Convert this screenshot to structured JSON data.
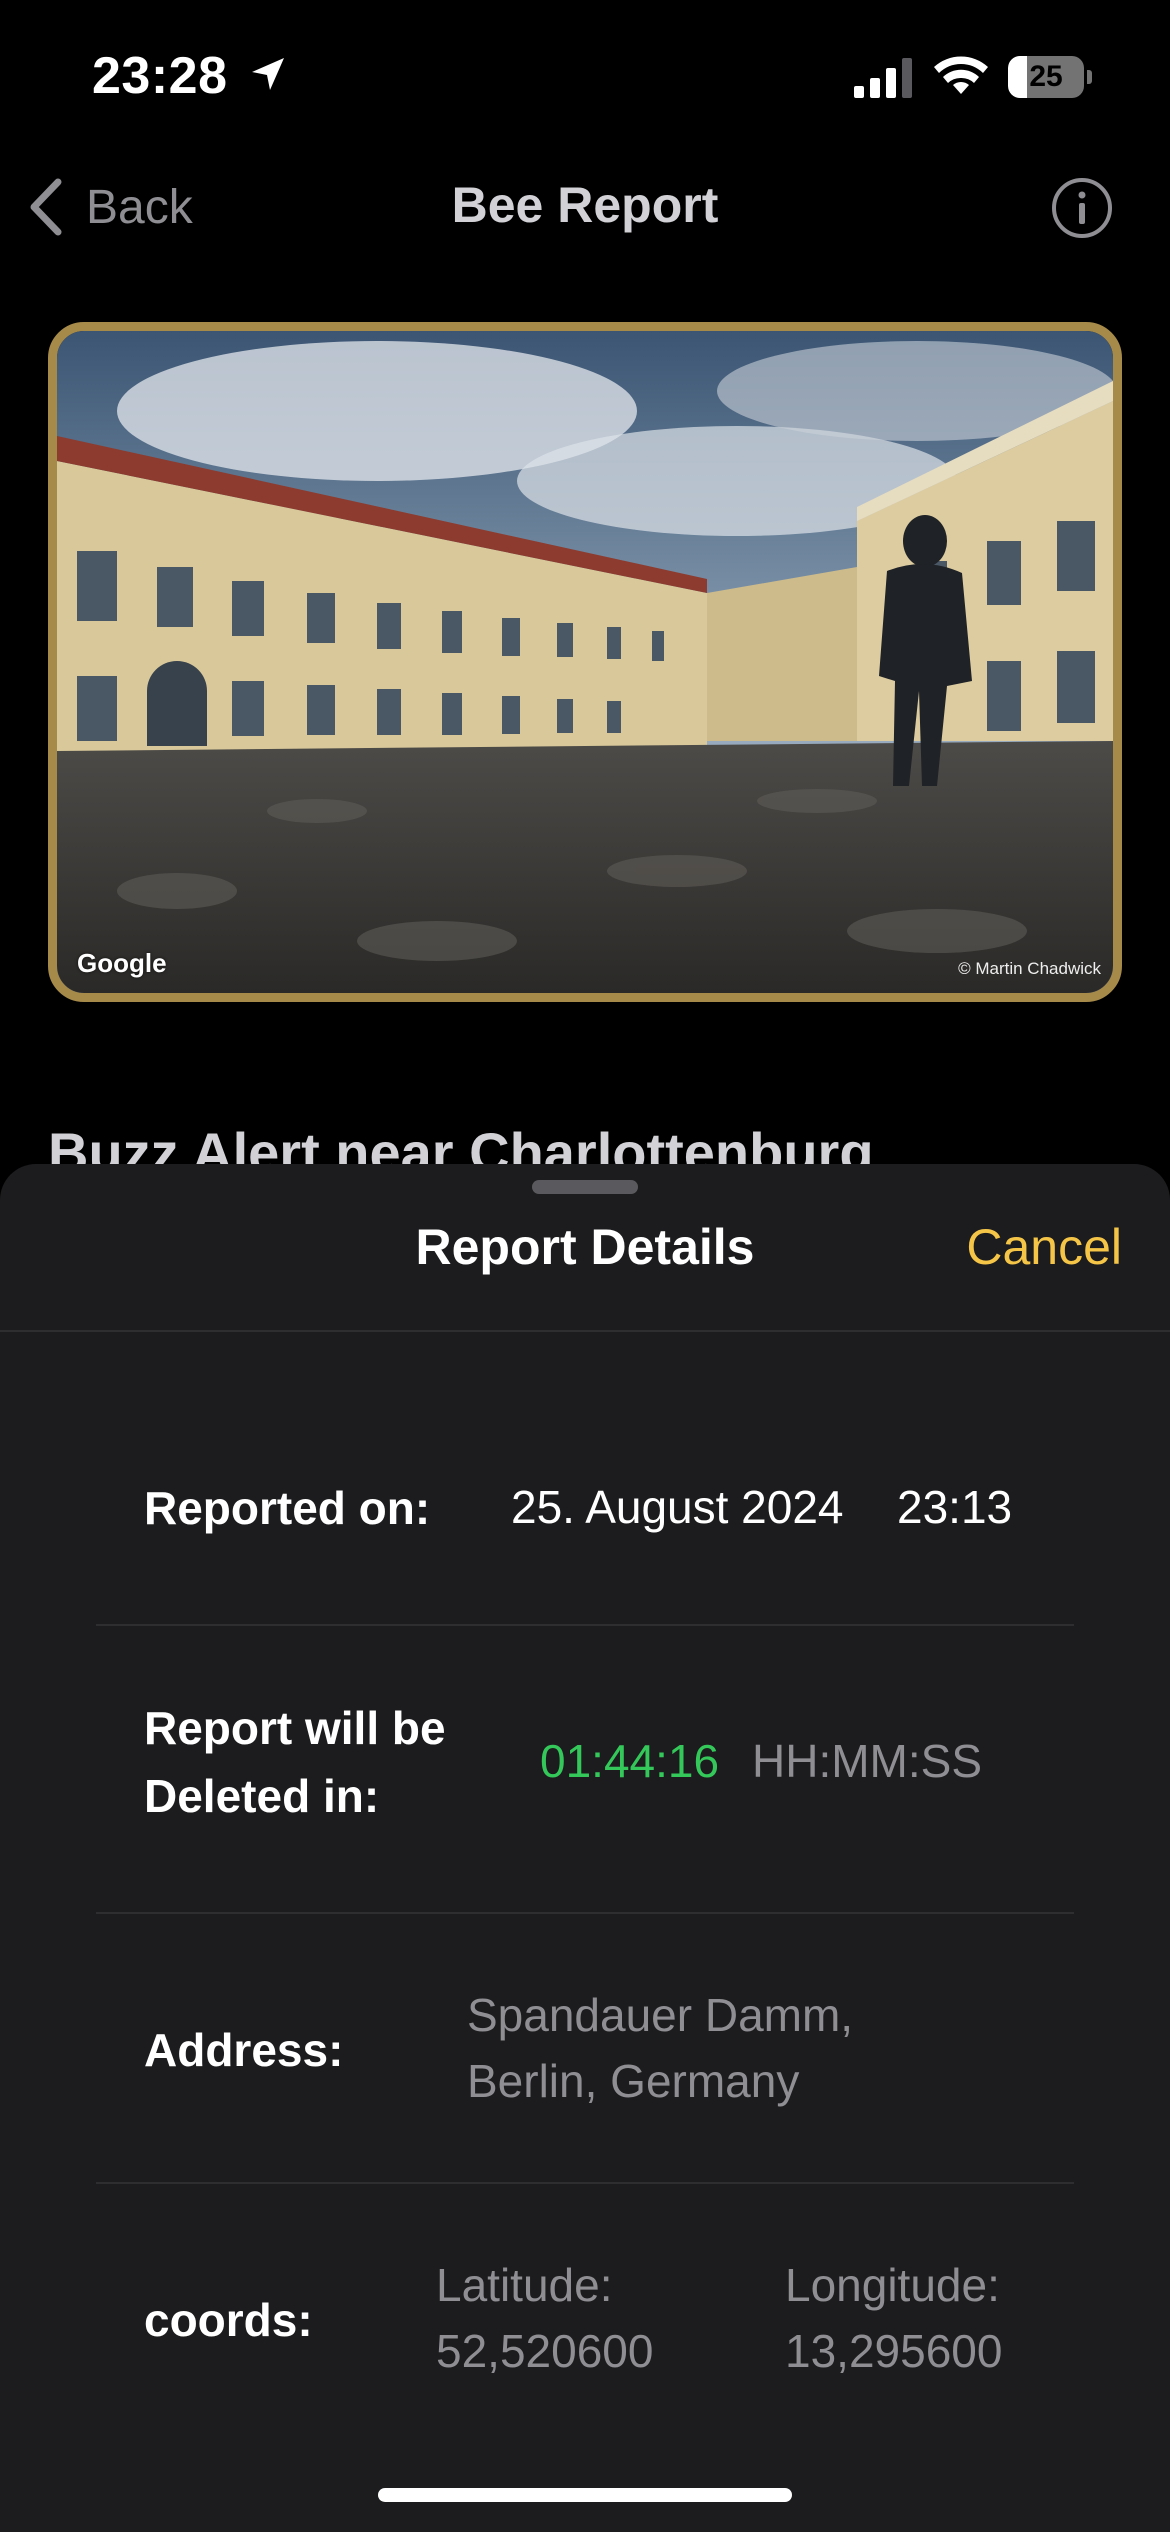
{
  "status_bar": {
    "time": "23:28",
    "battery_level": "25",
    "battery_percent": 25
  },
  "nav": {
    "back_label": "Back",
    "title": "Bee Report"
  },
  "photo": {
    "logo_text": "Google",
    "credit": "© Martin Chadwick"
  },
  "underlying_title": "Buzz Alert near Charlottenburg",
  "sheet": {
    "title": "Report Details",
    "cancel_label": "Cancel",
    "reported_on": {
      "label": "Reported on:",
      "date": "25. August 2024",
      "time": "23:13"
    },
    "deletion": {
      "label_line1": "Report will be",
      "label_line2": "Deleted in:",
      "countdown": "01:44:16",
      "format": "HH:MM:SS",
      "countdown_color": "#34c759"
    },
    "address": {
      "label": "Address:",
      "line1": "Spandauer Damm,",
      "line2": "Berlin, Germany"
    },
    "coords": {
      "label": "coords:",
      "lat_label": "Latitude:",
      "lat_value": "52,520600",
      "lon_label": "Longitude:",
      "lon_value": "13,295600"
    }
  },
  "colors": {
    "accent": "#f5c548",
    "frame": "#a68a4a",
    "secondary_text": "#8e8e93",
    "sheet_bg": "#1c1c1e"
  }
}
